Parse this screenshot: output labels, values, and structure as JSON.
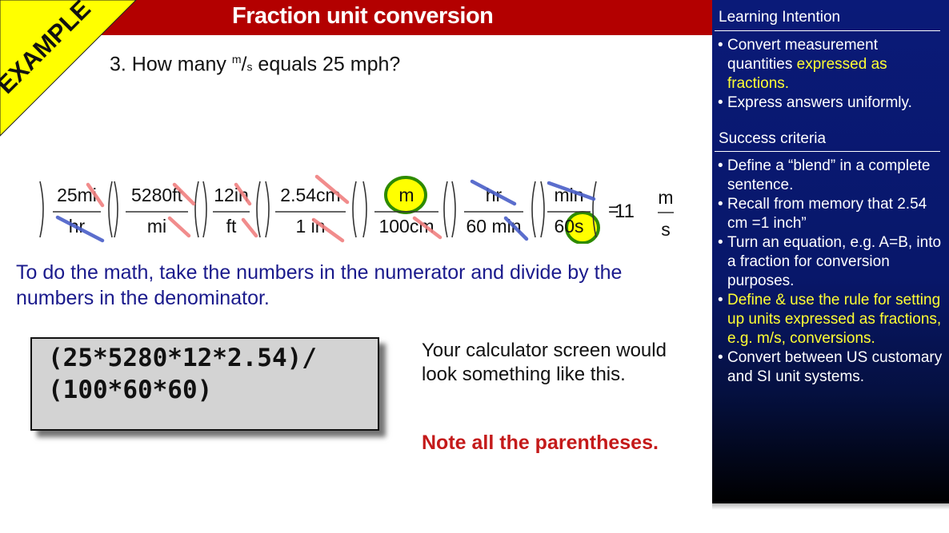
{
  "slide": {
    "title": "Fraction unit conversion",
    "corner_label": "EXAMPLE",
    "question": {
      "prefix": "3. How many ",
      "unit_num": "m",
      "slash": "/",
      "unit_den": "s",
      "suffix": " equals 25 mph?"
    },
    "equation": {
      "fractions": [
        {
          "num": "25mi",
          "den": "hr"
        },
        {
          "num": "5280ft",
          "den": "mi"
        },
        {
          "num": "12in",
          "den": "ft"
        },
        {
          "num": "2.54cm",
          "den": "1 in"
        },
        {
          "num": "m",
          "den": "100cm"
        },
        {
          "num": "hr",
          "den": "60 min"
        },
        {
          "num": "min",
          "den": "60s"
        }
      ],
      "equals": "=",
      "result": "11",
      "result_num": "m",
      "result_den": "s"
    },
    "instruction": "To do the math, take the numbers in the numerator and divide by the numbers in the denominator.",
    "calculator": {
      "line1": "(25*5280*12*2.54)/",
      "line2": "(100*60*60)"
    },
    "calculator_note": "Your calculator screen would look something like this.",
    "parentheses_note": "Note all the parentheses."
  },
  "panel": {
    "learning_heading": "Learning Intention",
    "learning_items": [
      {
        "parts": [
          {
            "text": "Convert measurement quantities ",
            "hl": false
          },
          {
            "text": "expressed as fractions.",
            "hl": true
          }
        ]
      },
      {
        "parts": [
          {
            "text": "Express answers uniformly.",
            "hl": false
          }
        ]
      }
    ],
    "success_heading": "Success criteria",
    "success_items": [
      {
        "parts": [
          {
            "text": "Define a “blend” in a complete sentence.",
            "hl": false
          }
        ]
      },
      {
        "parts": [
          {
            "text": "Recall from memory that 2.54 cm =1 inch”",
            "hl": false
          }
        ]
      },
      {
        "parts": [
          {
            "text": "Turn an equation, e.g. A=B, into a fraction for conversion purposes.",
            "hl": false
          }
        ]
      },
      {
        "parts": [
          {
            "text": "Define & use the rule for setting up units expressed as fractions, e.g. m/s, conversions.",
            "hl": true
          }
        ]
      },
      {
        "parts": [
          {
            "text": "Convert between US customary and SI unit systems.",
            "hl": false
          }
        ]
      }
    ],
    "bullet": "•"
  },
  "colors": {
    "title_bar": "#b30000",
    "corner_yellow": "#ffff00",
    "cancel_red": "#f08080",
    "cancel_blue": "#4a5fc8",
    "highlight_yellow": "#ffff33",
    "circle_green": "#2e8b00",
    "instruction_blue": "#1a1a8c",
    "note_red": "#c41a1a",
    "panel_blue": "#0a1a78"
  }
}
